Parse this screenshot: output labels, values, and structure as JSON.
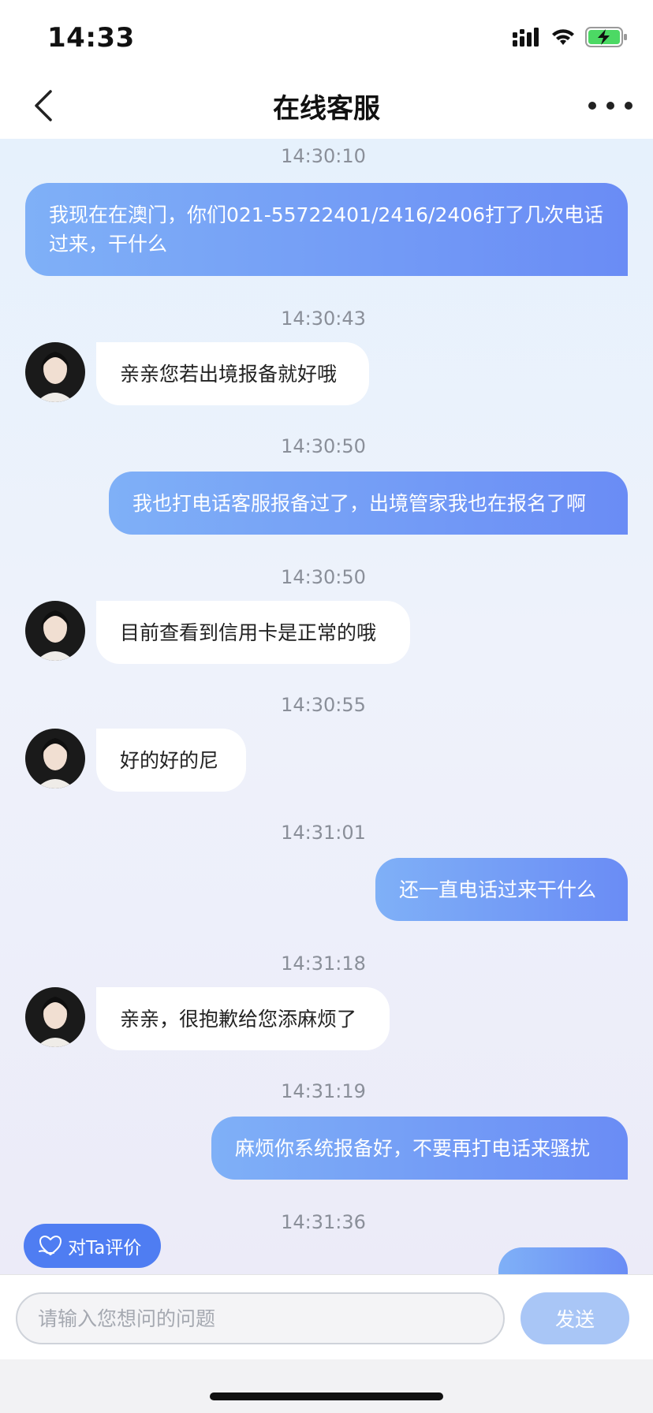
{
  "status_bar": {
    "time": "14:33"
  },
  "nav": {
    "title": "在线客服"
  },
  "messages": [
    {
      "time": "14:30:10",
      "side": "out",
      "text": "我现在在澳门，你们021-55722401/2416/2406打了几次电话过来，干什么"
    },
    {
      "time": "14:30:43",
      "side": "in",
      "text": "亲亲您若出境报备就好哦"
    },
    {
      "time": "14:30:50",
      "side": "out",
      "text": "我也打电话客服报备过了，出境管家我也在报名了啊"
    },
    {
      "time": "14:30:50",
      "side": "in",
      "text": "目前查看到信用卡是正常的哦"
    },
    {
      "time": "14:30:55",
      "side": "in",
      "text": "好的好的尼"
    },
    {
      "time": "14:31:01",
      "side": "out",
      "text": "还一直电话过来干什么"
    },
    {
      "time": "14:31:18",
      "side": "in",
      "text": "亲亲，很抱歉给您添麻烦了"
    },
    {
      "time": "14:31:19",
      "side": "out",
      "text": "麻烦你系统报备好，不要再打电话来骚扰"
    },
    {
      "time": "14:31:36",
      "side": "out",
      "text": ""
    }
  ],
  "rate_button": {
    "label": "对Ta评价"
  },
  "input": {
    "placeholder": "请输入您想问的问题",
    "value": ""
  },
  "send_button": {
    "label": "发送"
  },
  "colors": {
    "outgoing_bubble_start": "#7fb0f7",
    "outgoing_bubble_end": "#6a8cf5",
    "rate_button": "#4f7df2",
    "send_button_disabled": "#a9c6f6"
  }
}
